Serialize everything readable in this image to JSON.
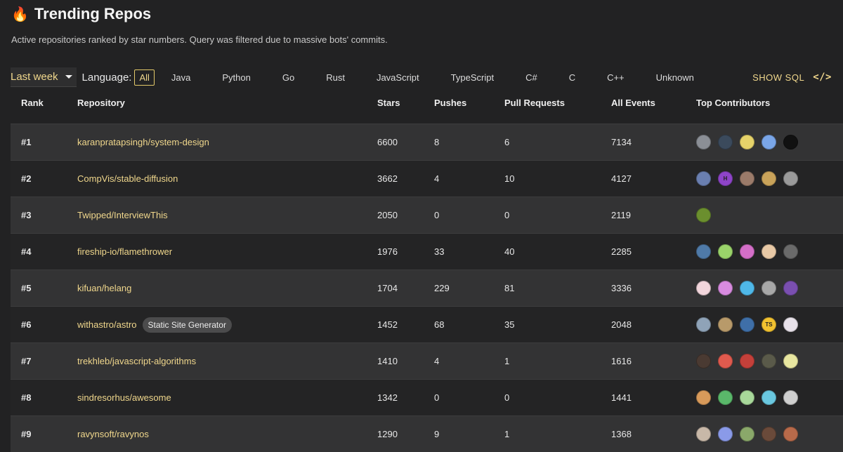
{
  "header": {
    "title": "Trending Repos",
    "subtitle": "Active repositories ranked by star numbers. Query was filtered due to massive bots' commits."
  },
  "filters": {
    "period": "Last week",
    "language_label": "Language:",
    "languages": [
      "All",
      "Java",
      "Python",
      "Go",
      "Rust",
      "JavaScript",
      "TypeScript",
      "C#",
      "C",
      "C++",
      "Unknown"
    ],
    "active_language": "All",
    "show_sql": "SHOW SQL",
    "code_icon": "</>"
  },
  "table": {
    "columns": [
      "Rank",
      "Repository",
      "Stars",
      "Pushes",
      "Pull Requests",
      "All Events",
      "Top Contributors"
    ],
    "rows": [
      {
        "rank": "#1",
        "repo": "karanpratapsingh/system-design",
        "tag": "",
        "stars": "6600",
        "pushes": "8",
        "prs": "6",
        "events": "7134",
        "avatars": [
          {
            "bg": "#8b8f96",
            "t": ""
          },
          {
            "bg": "#3b4a5c",
            "t": ""
          },
          {
            "bg": "#e6d36a",
            "t": ""
          },
          {
            "bg": "#7aa6e8",
            "t": ""
          },
          {
            "bg": "#111111",
            "t": ""
          }
        ]
      },
      {
        "rank": "#2",
        "repo": "CompVis/stable-diffusion",
        "tag": "",
        "stars": "3662",
        "pushes": "4",
        "prs": "10",
        "events": "4127",
        "avatars": [
          {
            "bg": "#6a7fb0",
            "t": ""
          },
          {
            "bg": "#8e44c8",
            "t": "H"
          },
          {
            "bg": "#9b7b6a",
            "t": ""
          },
          {
            "bg": "#c9a35a",
            "t": ""
          },
          {
            "bg": "#9a9a9a",
            "t": ""
          }
        ]
      },
      {
        "rank": "#3",
        "repo": "Twipped/InterviewThis",
        "tag": "",
        "stars": "2050",
        "pushes": "0",
        "prs": "0",
        "events": "2119",
        "avatars": [
          {
            "bg": "#6b8f2e",
            "t": ""
          }
        ]
      },
      {
        "rank": "#4",
        "repo": "fireship-io/flamethrower",
        "tag": "",
        "stars": "1976",
        "pushes": "33",
        "prs": "40",
        "events": "2285",
        "avatars": [
          {
            "bg": "#4f7aa8",
            "t": ""
          },
          {
            "bg": "#9ad36a",
            "t": ""
          },
          {
            "bg": "#d46fc8",
            "t": ""
          },
          {
            "bg": "#e8c9a6",
            "t": ""
          },
          {
            "bg": "#6a6a6a",
            "t": ""
          }
        ]
      },
      {
        "rank": "#5",
        "repo": "kifuan/helang",
        "tag": "",
        "stars": "1704",
        "pushes": "229",
        "prs": "81",
        "events": "3336",
        "avatars": [
          {
            "bg": "#f2d6dc",
            "t": ""
          },
          {
            "bg": "#d88be0",
            "t": ""
          },
          {
            "bg": "#4fb8e8",
            "t": ""
          },
          {
            "bg": "#a8a8a8",
            "t": ""
          },
          {
            "bg": "#7a4fb0",
            "t": ""
          }
        ]
      },
      {
        "rank": "#6",
        "repo": "withastro/astro",
        "tag": "Static Site Generator",
        "stars": "1452",
        "pushes": "68",
        "prs": "35",
        "events": "2048",
        "avatars": [
          {
            "bg": "#8fa3b8",
            "t": ""
          },
          {
            "bg": "#b89a6a",
            "t": ""
          },
          {
            "bg": "#3f6fa8",
            "t": ""
          },
          {
            "bg": "#f2c230",
            "t": "TS"
          },
          {
            "bg": "#e8e2ea",
            "t": ""
          }
        ]
      },
      {
        "rank": "#7",
        "repo": "trekhleb/javascript-algorithms",
        "tag": "",
        "stars": "1410",
        "pushes": "4",
        "prs": "1",
        "events": "1616",
        "avatars": [
          {
            "bg": "#4a3a32",
            "t": ""
          },
          {
            "bg": "#e05a4e",
            "t": ""
          },
          {
            "bg": "#c4403a",
            "t": ""
          },
          {
            "bg": "#5a5a4a",
            "t": ""
          },
          {
            "bg": "#e8e6a0",
            "t": ""
          }
        ]
      },
      {
        "rank": "#8",
        "repo": "sindresorhus/awesome",
        "tag": "",
        "stars": "1342",
        "pushes": "0",
        "prs": "0",
        "events": "1441",
        "avatars": [
          {
            "bg": "#d89a5a",
            "t": ""
          },
          {
            "bg": "#5ab86a",
            "t": ""
          },
          {
            "bg": "#a8d89a",
            "t": ""
          },
          {
            "bg": "#6ac8e0",
            "t": ""
          },
          {
            "bg": "#cfcfcf",
            "t": ""
          }
        ]
      },
      {
        "rank": "#9",
        "repo": "ravynsoft/ravynos",
        "tag": "",
        "stars": "1290",
        "pushes": "9",
        "prs": "1",
        "events": "1368",
        "avatars": [
          {
            "bg": "#c8b8a8",
            "t": ""
          },
          {
            "bg": "#8a9ae8",
            "t": ""
          },
          {
            "bg": "#8aa86a",
            "t": ""
          },
          {
            "bg": "#6a4a3a",
            "t": ""
          },
          {
            "bg": "#b86a4a",
            "t": ""
          }
        ]
      }
    ]
  }
}
